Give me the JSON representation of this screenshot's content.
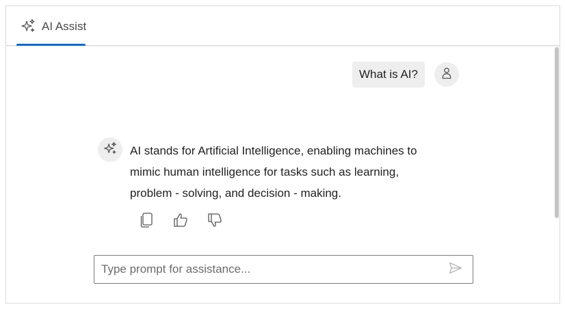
{
  "tab": {
    "label": "AI Assist",
    "icon": "sparkle-icon",
    "accent_color": "#0a6ad4"
  },
  "conversation": {
    "user_message": "What is AI?",
    "user_avatar_icon": "user-icon",
    "ai_avatar_icon": "sparkle-icon",
    "ai_response_lines": [
      "AI stands for Artificial Intelligence, enabling machines to",
      "mimic human intelligence for tasks such as learning,",
      "problem - solving, and decision - making."
    ],
    "response_actions": [
      {
        "icon": "copy-icon"
      },
      {
        "icon": "thumbs-up-icon"
      },
      {
        "icon": "thumbs-down-icon"
      }
    ]
  },
  "prompt": {
    "placeholder": "Type prompt for assistance...",
    "value": "",
    "send_icon": "send-icon"
  }
}
